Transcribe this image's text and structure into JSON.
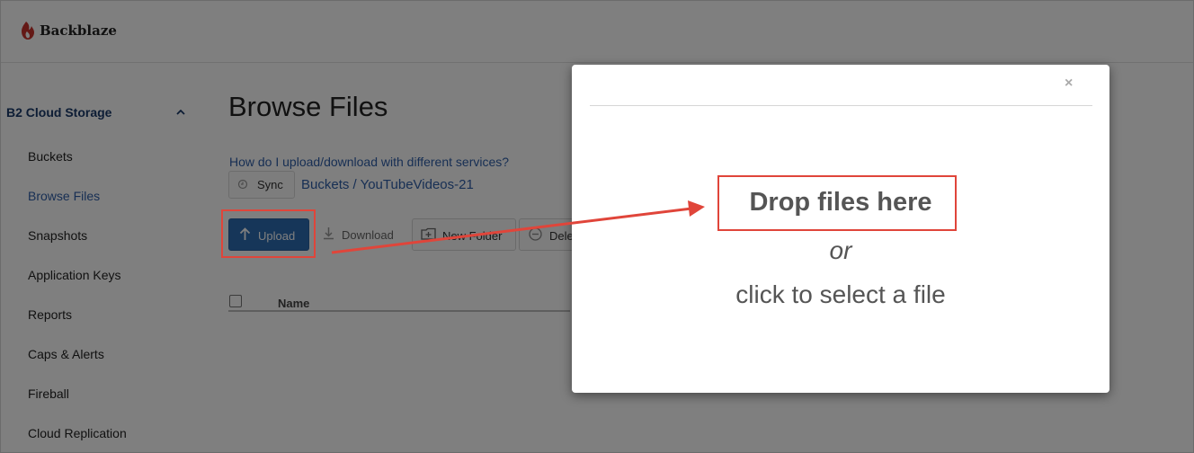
{
  "brand": {
    "name": "Backblaze"
  },
  "sidebar": {
    "section_title": "B2 Cloud Storage",
    "items": [
      {
        "label": "Buckets",
        "active": false
      },
      {
        "label": "Browse Files",
        "active": true
      },
      {
        "label": "Snapshots",
        "active": false
      },
      {
        "label": "Application Keys",
        "active": false
      },
      {
        "label": "Reports",
        "active": false
      },
      {
        "label": "Caps & Alerts",
        "active": false
      },
      {
        "label": "Fireball",
        "active": false
      },
      {
        "label": "Cloud Replication",
        "active": false
      }
    ]
  },
  "main": {
    "title": "Browse Files",
    "help_link": "How do I upload/download with different services?",
    "sync_label": "Sync",
    "breadcrumb": "Buckets / YouTubeVideos-21",
    "toolbar": {
      "upload_label": "Upload",
      "download_label": "Download",
      "new_folder_label": "New Folder",
      "delete_label": "Delete"
    },
    "table": {
      "columns": [
        "Name"
      ]
    }
  },
  "modal": {
    "close_symbol": "×",
    "drop_text": "Drop files here",
    "or_text": "or",
    "select_text": "click to select a file"
  },
  "colors": {
    "accent": "#2d6db3",
    "highlight": "#e0453a",
    "link": "#2f5ea8",
    "brand_red": "#c8332c"
  },
  "icons": [
    "backblaze-flame-icon",
    "chevron-up-icon",
    "sync-icon",
    "upload-arrow-icon",
    "download-icon",
    "new-folder-icon",
    "delete-icon",
    "close-icon"
  ]
}
